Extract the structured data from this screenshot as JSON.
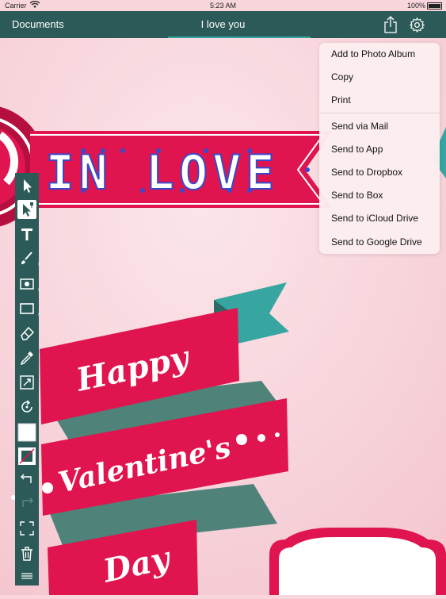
{
  "status_bar": {
    "carrier": "Carrier",
    "time": "5:23 AM",
    "battery": "100%"
  },
  "nav": {
    "back_label": "Documents",
    "title": "I love you",
    "share_icon": "share-icon",
    "settings_icon": "gear-icon"
  },
  "share_menu": {
    "items": [
      "Add to Photo Album",
      "Copy",
      "Print",
      "Send via Mail",
      "Send to App",
      "Send to Dropbox",
      "Send to Box",
      "Send to iCloud Drive",
      "Send to Google Drive"
    ]
  },
  "canvas": {
    "banner_text": "IN LOVE",
    "ribbon_lines": [
      "Happy",
      "Valentine's",
      "Day"
    ]
  },
  "toolbar": {
    "tools": [
      "arrow-select-icon",
      "node-select-icon",
      "text-tool-icon",
      "brush-icon",
      "image-tool-icon",
      "rectangle-tool-icon",
      "eraser-icon",
      "eyedropper-icon",
      "transform-icon",
      "rotate-icon",
      "fill-color-swatch",
      "stroke-color-swatch",
      "undo-icon",
      "redo-icon",
      "fit-screen-icon",
      "trash-icon",
      "layers-icon"
    ]
  },
  "colors": {
    "nav_bg": "#2c5a58",
    "accent_teal": "#37a6a0",
    "ribbon_red": "#e0144e",
    "ribbon_dark": "#b50f3f",
    "ribbon_shadow": "#4f8279",
    "background_pink": "#f8d6dc"
  }
}
